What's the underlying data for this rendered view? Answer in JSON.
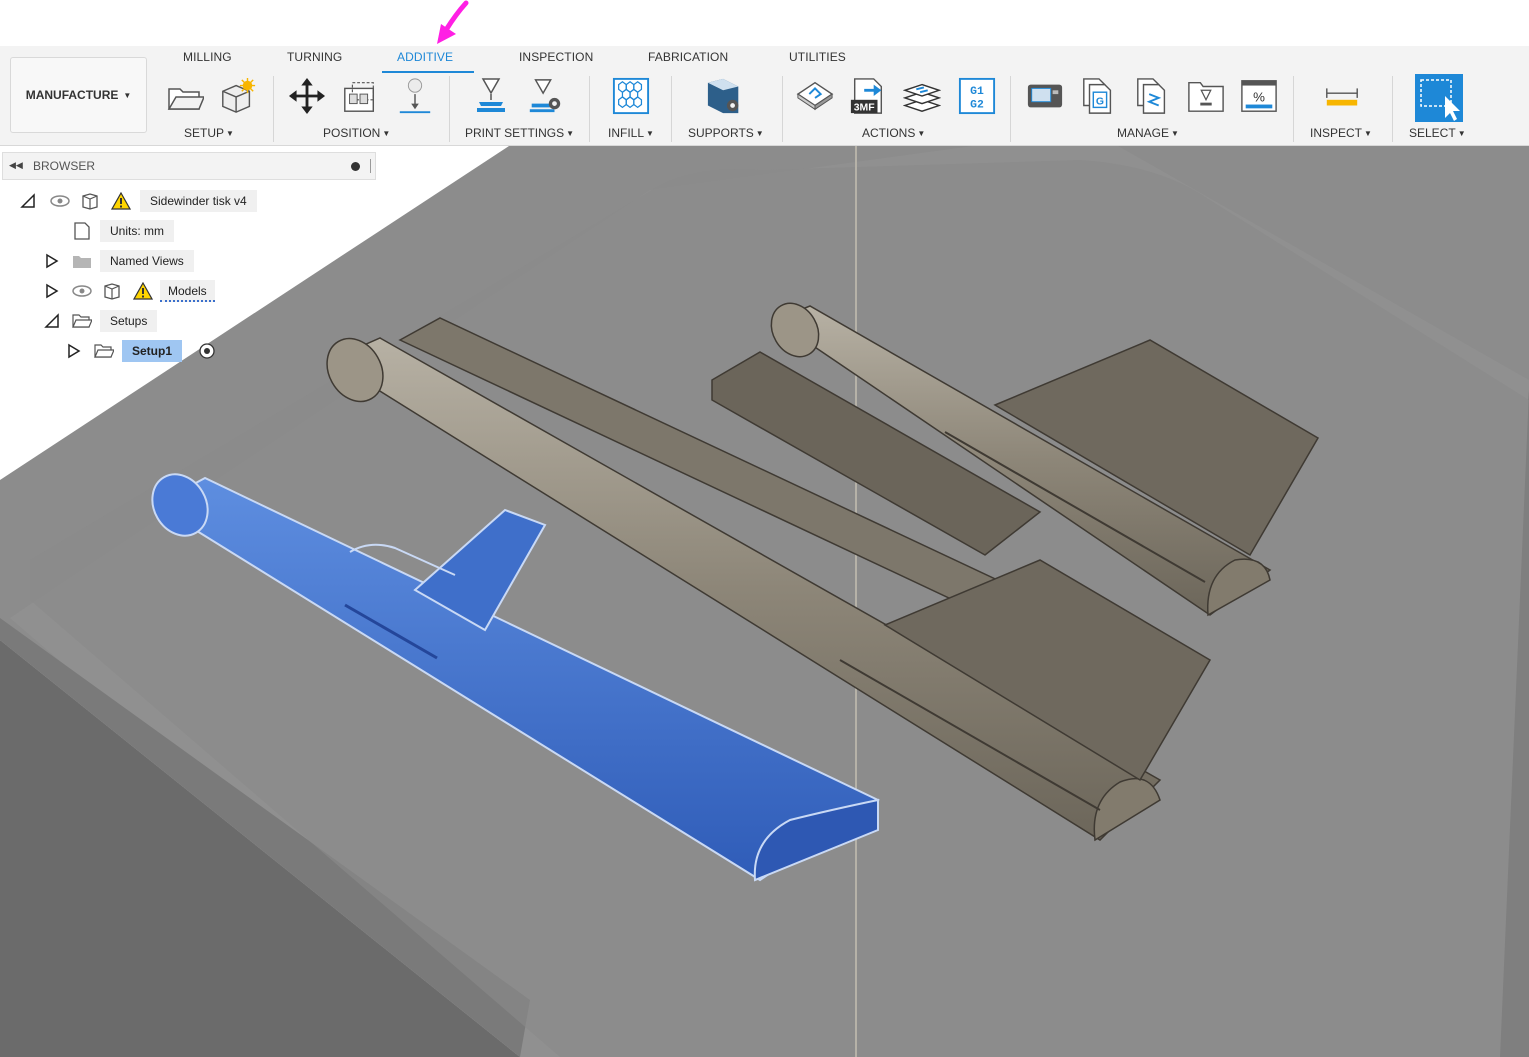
{
  "workspace": {
    "label": "MANUFACTURE",
    "arrow": "▼"
  },
  "tabs": [
    {
      "label": "MILLING",
      "active": false
    },
    {
      "label": "TURNING",
      "active": false
    },
    {
      "label": "ADDITIVE",
      "active": true
    },
    {
      "label": "INSPECTION",
      "active": false
    },
    {
      "label": "FABRICATION",
      "active": false
    },
    {
      "label": "UTILITIES",
      "active": false
    }
  ],
  "groups": {
    "setup": "SETUP",
    "position": "POSITION",
    "print_settings": "PRINT SETTINGS",
    "infill": "INFILL",
    "supports": "SUPPORTS",
    "actions": "ACTIONS",
    "manage": "MANAGE",
    "inspect": "INSPECT",
    "select": "SELECT"
  },
  "icons": {
    "setup": [
      "open-folder-icon",
      "new-setup-icon"
    ],
    "position": [
      "move-icon",
      "arrange-icon",
      "place-parts-icon"
    ],
    "print_settings": [
      "print-setting-icon",
      "print-setting-edit-icon"
    ],
    "infill": [
      "hex-infill-icon"
    ],
    "supports": [
      "support-icon"
    ],
    "actions": [
      "simulate-icon",
      "export-3mf-icon",
      "layers-icon",
      "gcode-icon"
    ],
    "manage": [
      "machine-library-icon",
      "post-library-icon",
      "template-library-icon",
      "print-library-icon",
      "percent-icon"
    ],
    "inspect": [
      "measure-icon"
    ],
    "select": [
      "select-icon"
    ]
  },
  "accent_color": "#1e88d7",
  "annotation_color": "#ff1fe4",
  "browser": {
    "title": "BROWSER",
    "nodes": {
      "root": "Sidewinder tisk v4",
      "units": "Units: mm",
      "named_views": "Named Views",
      "models": "Models",
      "setups": "Setups",
      "setup1": "Setup1"
    }
  },
  "viewport": {
    "selected_color": "#3a6fcc",
    "part_color": "#8a8374",
    "bed_color": "#7a7a7a"
  }
}
